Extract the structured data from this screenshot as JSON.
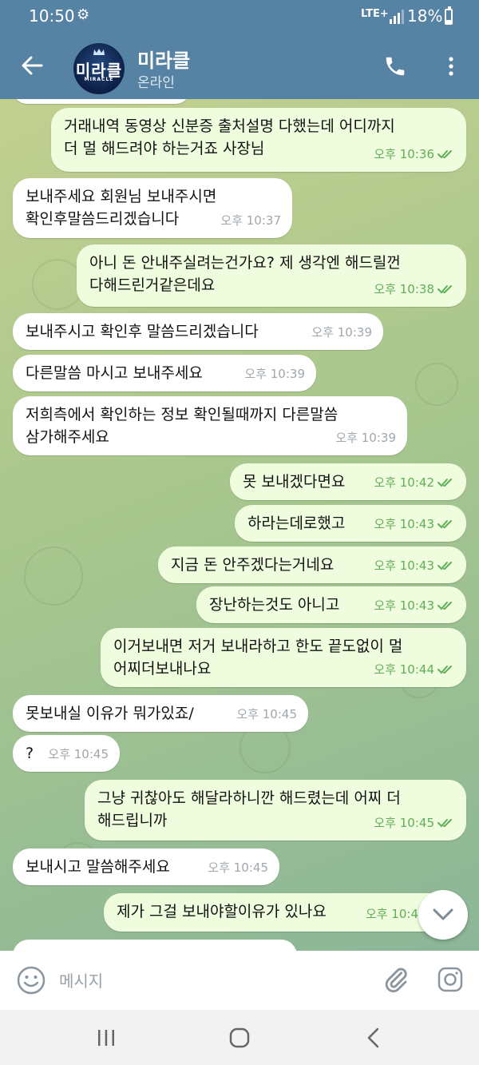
{
  "status_bar": {
    "time": "10:50",
    "network": "LTE+",
    "battery": "18%"
  },
  "header": {
    "avatar_text": "미라클",
    "avatar_subtext": "MIRACLE",
    "name": "미라클",
    "status": "온라인"
  },
  "messages": [
    {
      "dir": "out",
      "text": "거래내역 동영상 신분증 출처설명 다했는데 어디까지\n더 멀 해드려야 하는거죠 사장님",
      "time": "오후 10:36",
      "read": true
    },
    {
      "dir": "in",
      "text": "보내주세요 회원님 보내주시면\n확인후말씀드리겠습니다",
      "time": "오후 10:37"
    },
    {
      "dir": "out",
      "text": "아니 돈 안내주실려는건가요? 제 생각엔 해드릴껀\n다해드린거같은데요",
      "time": "오후 10:38",
      "read": true
    },
    {
      "dir": "in",
      "text": "보내주시고 확인후 말씀드리겠습니다",
      "time": "오후 10:39"
    },
    {
      "dir": "in",
      "text": "다른말씀 마시고 보내주세요",
      "time": "오후 10:39"
    },
    {
      "dir": "in",
      "text": "저희측에서 확인하는 정보 확인될때까지 다른말씀\n삼가해주세요",
      "time": "오후 10:39"
    },
    {
      "dir": "out",
      "text": "못 보내겠다면요",
      "time": "오후 10:42",
      "read": true
    },
    {
      "dir": "out",
      "text": "하라는데로했고",
      "time": "오후 10:43",
      "read": true
    },
    {
      "dir": "out",
      "text": "지금 돈 안주겠다는거네요",
      "time": "오후 10:43",
      "read": true
    },
    {
      "dir": "out",
      "text": "장난하는것도 아니고",
      "time": "오후 10:43",
      "read": true
    },
    {
      "dir": "out",
      "text": "이거보내면 저거 보내라하고 한도 끝도없이 멀\n어찌더보내나요",
      "time": "오후 10:44",
      "read": true
    },
    {
      "dir": "in",
      "text": "못보내실 이유가 뭐가있죠/",
      "time": "오후 10:45"
    },
    {
      "dir": "in",
      "text": "?",
      "time": "오후 10:45"
    },
    {
      "dir": "out",
      "text": "그냥 귀찮아도 해달라하니깐 해드렸는데 어찌 더\n해드립니까",
      "time": "오후 10:45",
      "read": true
    },
    {
      "dir": "in",
      "text": "보내시고 말씀해주세요",
      "time": "오후 10:45"
    },
    {
      "dir": "out",
      "text": "제가 그걸 보내야할이유가 있나요",
      "time": "오후 10:4",
      "read": true
    }
  ],
  "input": {
    "placeholder": "메시지"
  }
}
